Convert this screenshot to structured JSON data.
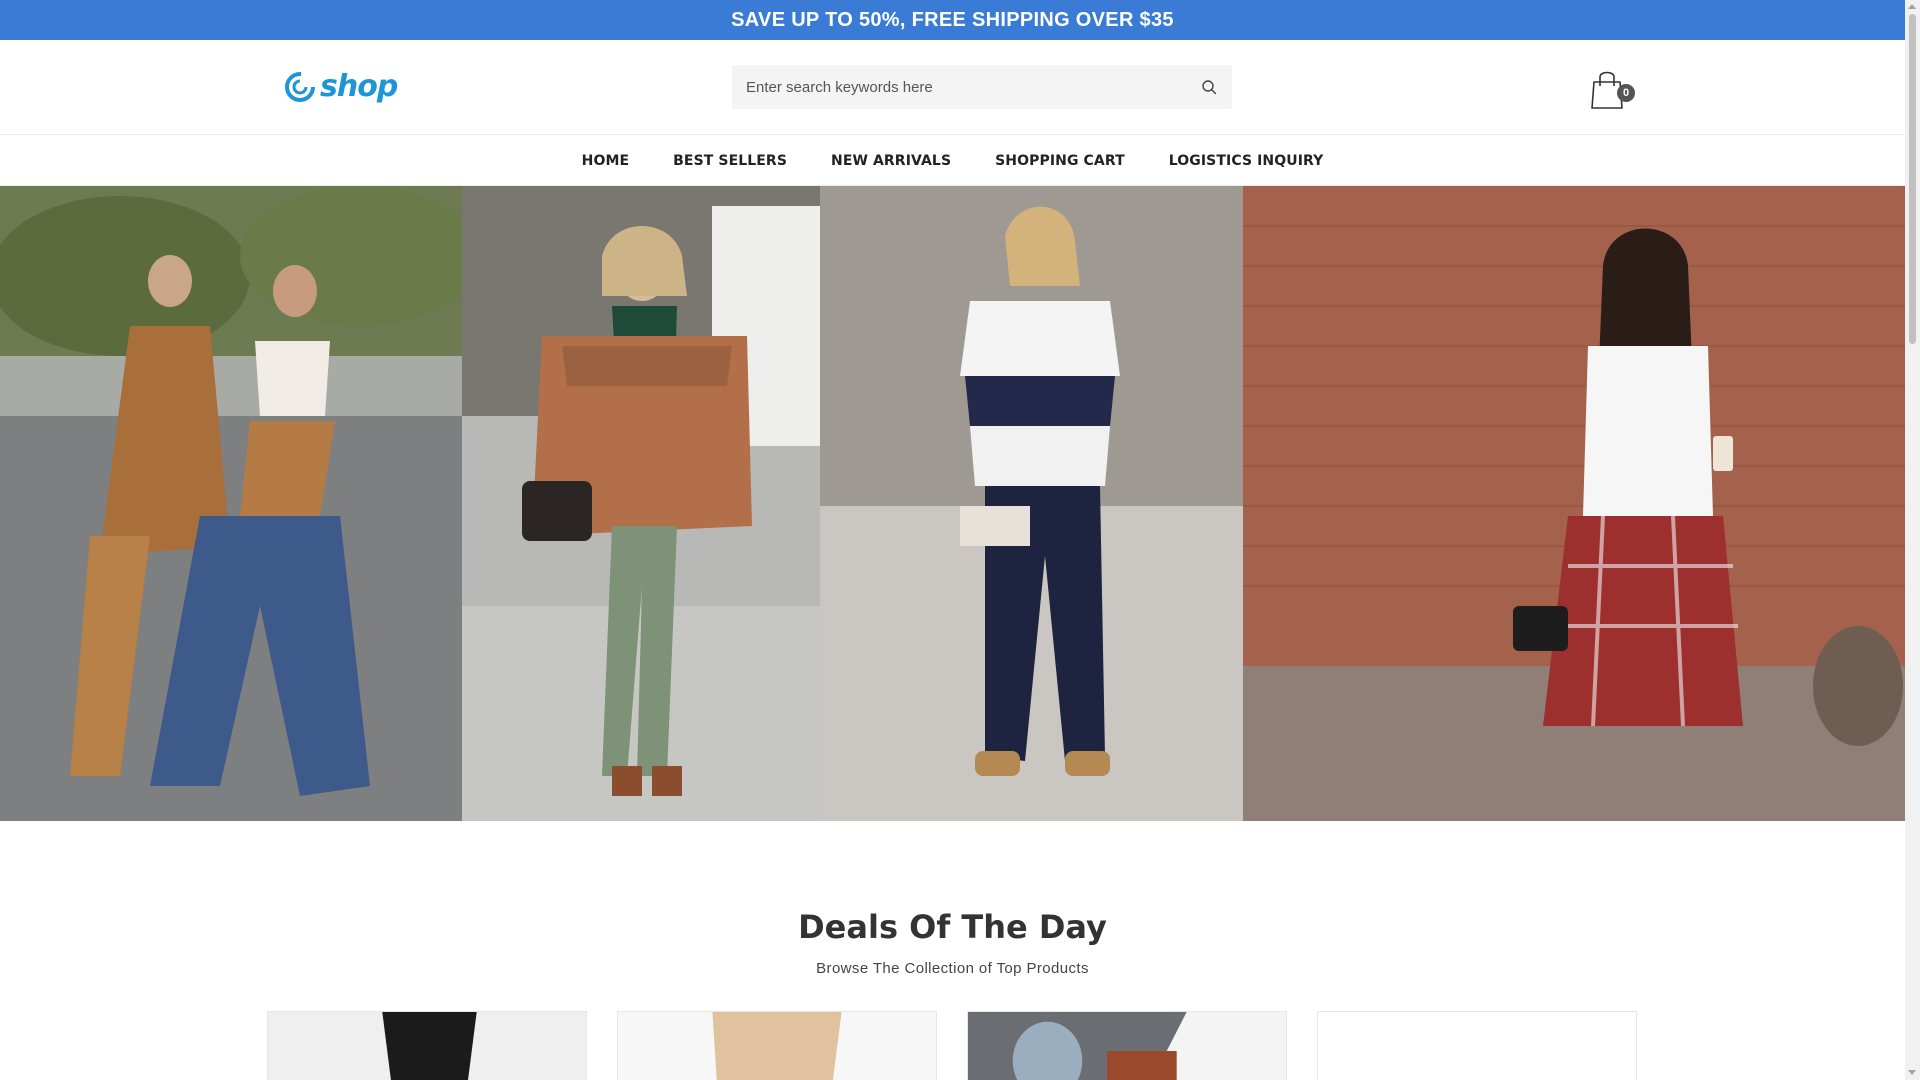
{
  "promo": {
    "text": "SAVE UP TO 50%, FREE SHIPPING OVER $35"
  },
  "brand": {
    "name": "shop",
    "color": "#1e95d9",
    "icon": "swirl-logo-icon"
  },
  "search": {
    "placeholder": "Enter search keywords here",
    "value": "",
    "icon": "search-icon"
  },
  "cart": {
    "count": "0",
    "icon": "shopping-bag-icon"
  },
  "nav": {
    "items": [
      {
        "label": "HOME"
      },
      {
        "label": "BEST SELLERS"
      },
      {
        "label": "NEW ARRIVALS"
      },
      {
        "label": "SHOPPING CART"
      },
      {
        "label": "LOGISTICS INQUIRY"
      }
    ]
  },
  "deals": {
    "title": "Deals Of The Day",
    "subtitle": "Browse The Collection of Top Products"
  },
  "colors": {
    "promo_bg": "#3a7bd5",
    "accent": "#1e95d9"
  }
}
